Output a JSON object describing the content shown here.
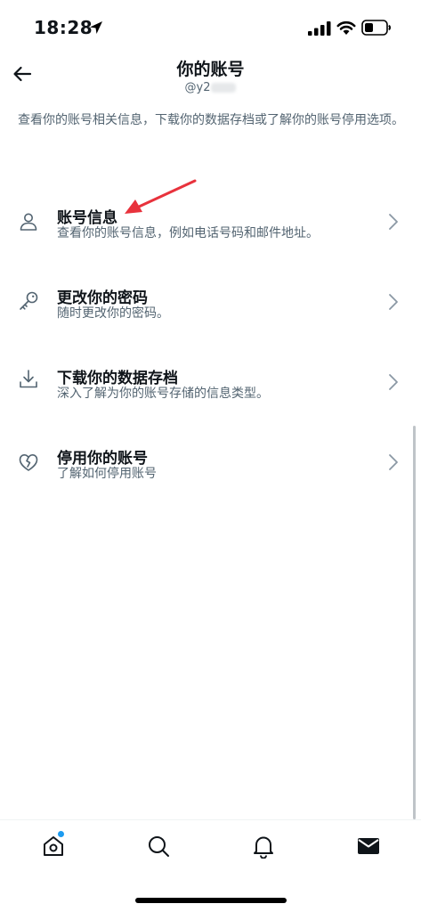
{
  "status_bar": {
    "time": "18:28"
  },
  "header": {
    "title": "你的账号",
    "handle": "@y2"
  },
  "description": "查看你的账号相关信息，下载你的数据存档或了解你的账号停用选项。",
  "menu": [
    {
      "icon": "person-icon",
      "title": "账号信息",
      "subtitle": "查看你的账号信息，例如电话号码和邮件地址。"
    },
    {
      "icon": "key-icon",
      "title": "更改你的密码",
      "subtitle": "随时更改你的密码。"
    },
    {
      "icon": "download-icon",
      "title": "下载你的数据存档",
      "subtitle": "深入了解为你的账号存储的信息类型。"
    },
    {
      "icon": "broken-heart-icon",
      "title": "停用你的账号",
      "subtitle": "了解如何停用账号"
    }
  ],
  "bottom_nav": [
    {
      "icon": "home-icon",
      "has_notification_dot": true
    },
    {
      "icon": "search-icon"
    },
    {
      "icon": "bell-icon"
    },
    {
      "icon": "mail-icon",
      "active": true
    }
  ],
  "colors": {
    "accent": "#1d9bf0",
    "annotation": "#e8323c",
    "secondary_text": "#536471"
  }
}
